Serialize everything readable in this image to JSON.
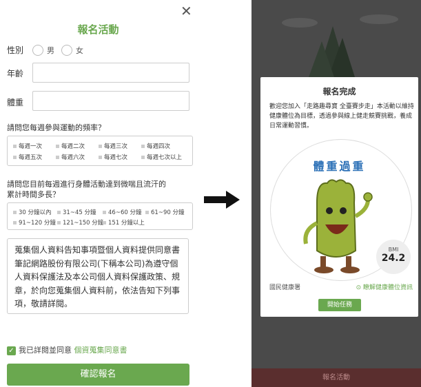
{
  "form": {
    "close_icon": "close-icon",
    "title": "報名活動",
    "gender_label": "性別",
    "gender_options": [
      "男",
      "女"
    ],
    "age_label": "年齡",
    "weight_label": "體重",
    "frequency_question": "請問您每週參與運動的頻率？",
    "frequency_options": [
      "每週一次",
      "每週二次",
      "每週三次",
      "每週四次",
      "每週五次",
      "每週六次",
      "每週七次",
      "每週七次以上"
    ],
    "duration_question_line1": "請問您目前每週進行身體活動達到微喘且流汗的",
    "duration_question_line2": "累計時間多長？",
    "duration_options": [
      "30 分鐘以內",
      "31~45 分鐘",
      "46~60 分鐘",
      "61~90 分鐘",
      "91~120 分鐘",
      "121~150 分鐘",
      "151 分鐘以上"
    ],
    "terms_text": "蒐集個人資料告知事項暨個人資料提供同意書筆記網路股份有限公司(下稱本公司)為遵守個人資料保護法及本公司個人資料保護政策、規章，於向您蒐集個人資料前，依法告知下列事項，敬請詳閱。",
    "agree_prefix": "我已詳閱並同意",
    "agree_link": "個資蒐集同意書",
    "submit_label": "確認報名"
  },
  "modal": {
    "title": "報名完成",
    "body": "歡迎您加入「走路趣尋寶 全臺賽步走」本活動以維持健康體位為目標，透過參與線上健走競賽挑戰，養成日常運動習慣。",
    "weight_status": "體重過重",
    "bmi_label": "BMI",
    "bmi_value": "24.2",
    "footer_left": "國民健康署",
    "footer_right": "瞭解健康體位資訊",
    "start_label": "開始任務"
  },
  "background": {
    "bottom_bar": "報名活動"
  },
  "colors": {
    "accent_green": "#6aa84f",
    "overlay_dark": "#4a4a4a",
    "title_blue": "#2a6fb6"
  }
}
